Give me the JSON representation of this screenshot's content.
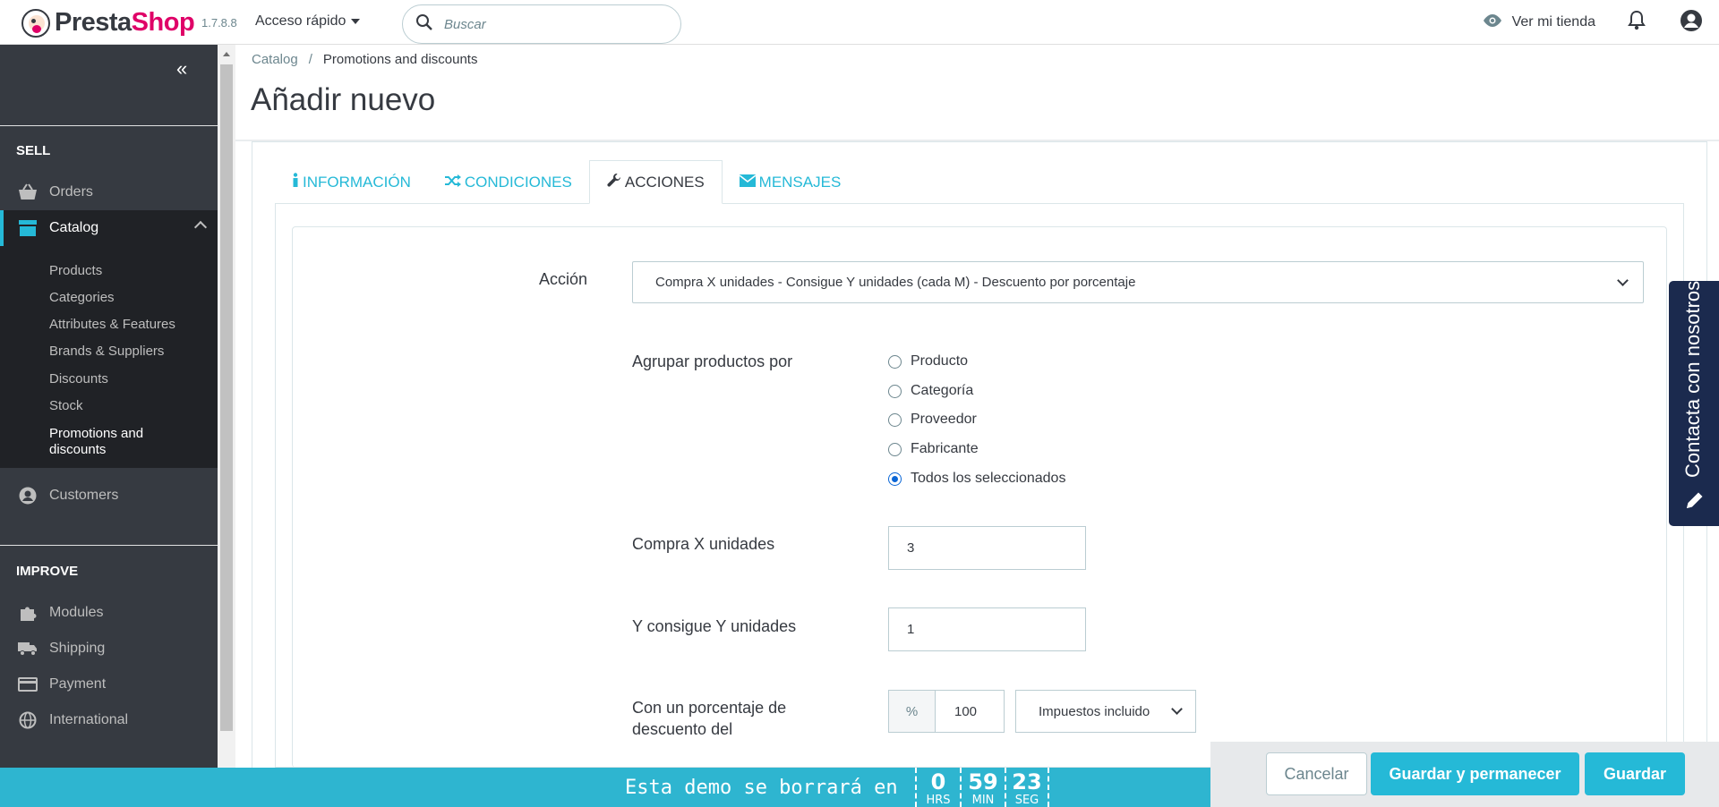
{
  "header": {
    "logo_presta": "Presta",
    "logo_shop": "Shop",
    "version": "1.7.8.8",
    "quick_access": "Acceso rápido",
    "search_placeholder": "Buscar",
    "view_store": "Ver mi tienda"
  },
  "sidebar": {
    "sell_label": "SELL",
    "improve_label": "IMPROVE",
    "items": {
      "orders": "Orders",
      "catalog": "Catalog",
      "customers": "Customers",
      "modules": "Modules",
      "shipping": "Shipping",
      "payment": "Payment",
      "international": "International"
    },
    "catalog_sub": [
      "Products",
      "Categories",
      "Attributes & Features",
      "Brands & Suppliers",
      "Discounts",
      "Stock",
      "Promotions and",
      "discounts"
    ]
  },
  "breadcrumb": {
    "parent": "Catalog",
    "separator": "/",
    "current": "Promotions and discounts"
  },
  "page_title": "Añadir nuevo",
  "tabs": [
    {
      "label": "INFORMACIÓN",
      "icon": "info-icon"
    },
    {
      "label": "CONDICIONES",
      "icon": "shuffle-icon"
    },
    {
      "label": "ACCIONES",
      "icon": "wrench-icon"
    },
    {
      "label": "MENSAJES",
      "icon": "envelope-icon"
    }
  ],
  "form": {
    "action_label": "Acción",
    "action_value": "Compra X unidades - Consigue Y unidades (cada M) - Descuento por porcentaje",
    "group_label": "Agrupar productos por",
    "group_options": [
      "Producto",
      "Categoría",
      "Proveedor",
      "Fabricante",
      "Todos los seleccionados"
    ],
    "group_selected": "Todos los seleccionados",
    "buy_x_label": "Compra X unidades",
    "buy_x_value": "3",
    "get_y_label": "Y consigue Y unidades",
    "get_y_value": "1",
    "discount_label_line1": "Con un porcentaje de",
    "discount_label_line2": "descuento del",
    "discount_addon": "%",
    "discount_value": "100",
    "tax_value": "Impuestos incluido"
  },
  "contact_tab": "Contacta con nosotros",
  "demo_bar": {
    "text": "Esta demo se borrará en",
    "hours": "0",
    "hours_label": "HRS",
    "minutes": "59",
    "minutes_label": "MIN",
    "seconds": "23",
    "seconds_label": "SEG"
  },
  "actions": {
    "cancel": "Cancelar",
    "save_stay": "Guardar y permanecer",
    "save": "Guardar"
  },
  "colors": {
    "accent": "#25b9d7",
    "sidebar_bg": "#363a41",
    "brand_pink": "#df0067",
    "contact_bg": "#1b2a4e"
  }
}
